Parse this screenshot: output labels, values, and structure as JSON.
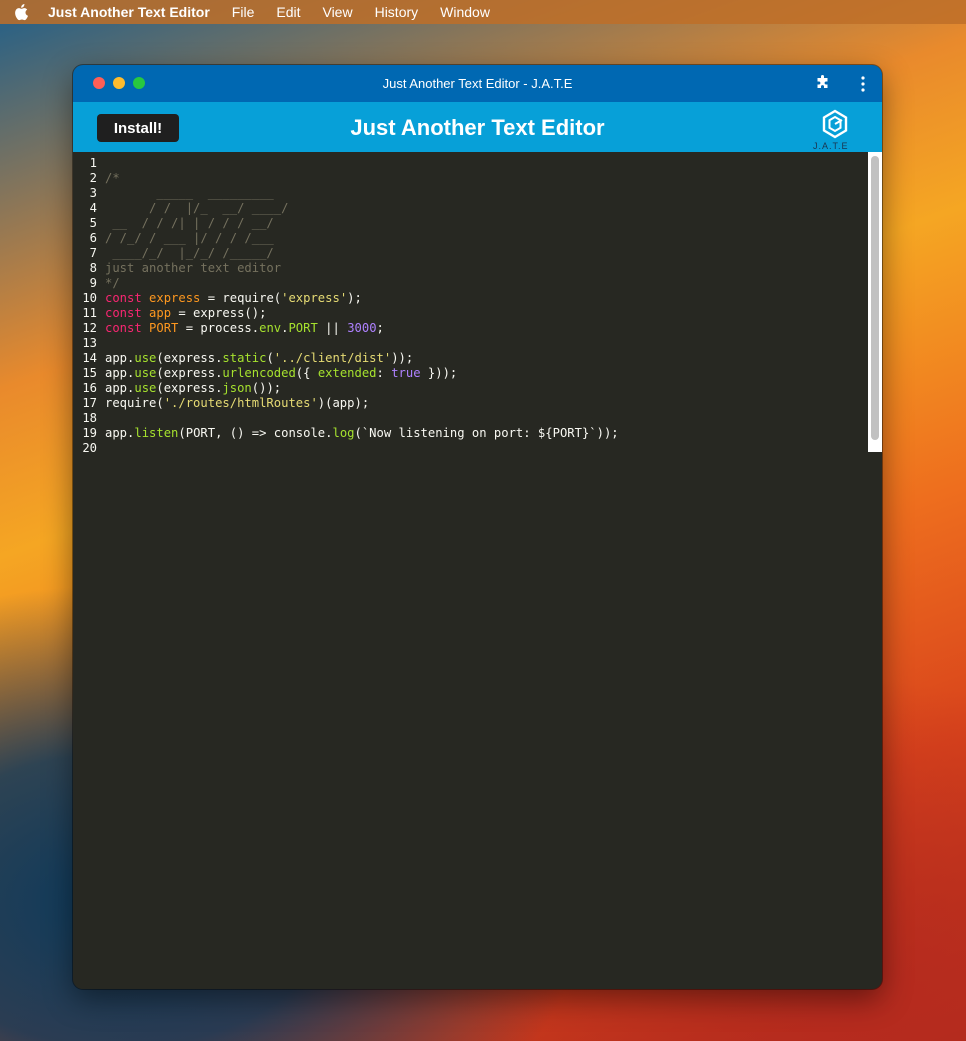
{
  "menubar": {
    "app_name": "Just Another Text Editor",
    "items": [
      "File",
      "Edit",
      "View",
      "History",
      "Window"
    ]
  },
  "window": {
    "title": "Just Another Text Editor - J.A.T.E"
  },
  "header": {
    "install_label": "Install!",
    "title": "Just Another Text Editor",
    "logo_text": "J.A.T.E"
  },
  "editor": {
    "lines": [
      {
        "n": "1",
        "t": [
          {
            "c": "",
            "t": ""
          }
        ]
      },
      {
        "n": "2",
        "t": [
          {
            "c": "c",
            "t": "/*"
          }
        ]
      },
      {
        "n": "3",
        "t": [
          {
            "c": "c",
            "t": "       _____  _________"
          }
        ]
      },
      {
        "n": "4",
        "t": [
          {
            "c": "c",
            "t": "      / /  |/_  __/ ____/"
          }
        ]
      },
      {
        "n": "5",
        "t": [
          {
            "c": "c",
            "t": " __  / / /| | / / / __/"
          }
        ]
      },
      {
        "n": "6",
        "t": [
          {
            "c": "c",
            "t": "/ /_/ / ___ |/ / / /___"
          }
        ]
      },
      {
        "n": "7",
        "t": [
          {
            "c": "c",
            "t": " ____/_/  |_/_/ /_____/"
          }
        ]
      },
      {
        "n": "8",
        "t": [
          {
            "c": "c",
            "t": "just another text editor"
          }
        ]
      },
      {
        "n": "9",
        "t": [
          {
            "c": "c",
            "t": "*/"
          }
        ]
      },
      {
        "n": "10",
        "t": [
          {
            "c": "k",
            "t": "const "
          },
          {
            "c": "v",
            "t": "express"
          },
          {
            "c": "",
            "t": " = require("
          },
          {
            "c": "s",
            "t": "'express'"
          },
          {
            "c": "",
            "t": ");"
          }
        ]
      },
      {
        "n": "11",
        "t": [
          {
            "c": "k",
            "t": "const "
          },
          {
            "c": "v",
            "t": "app"
          },
          {
            "c": "",
            "t": " = express();"
          }
        ]
      },
      {
        "n": "12",
        "t": [
          {
            "c": "k",
            "t": "const "
          },
          {
            "c": "v",
            "t": "PORT"
          },
          {
            "c": "",
            "t": " = process."
          },
          {
            "c": "f",
            "t": "env"
          },
          {
            "c": "",
            "t": "."
          },
          {
            "c": "f",
            "t": "PORT"
          },
          {
            "c": "",
            "t": " || "
          },
          {
            "c": "n",
            "t": "3000"
          },
          {
            "c": "",
            "t": ";"
          }
        ]
      },
      {
        "n": "13",
        "t": [
          {
            "c": "",
            "t": ""
          }
        ]
      },
      {
        "n": "14",
        "t": [
          {
            "c": "",
            "t": "app."
          },
          {
            "c": "f",
            "t": "use"
          },
          {
            "c": "",
            "t": "(express."
          },
          {
            "c": "f",
            "t": "static"
          },
          {
            "c": "",
            "t": "("
          },
          {
            "c": "s",
            "t": "'../client/dist'"
          },
          {
            "c": "",
            "t": "));"
          }
        ]
      },
      {
        "n": "15",
        "t": [
          {
            "c": "",
            "t": "app."
          },
          {
            "c": "f",
            "t": "use"
          },
          {
            "c": "",
            "t": "(express."
          },
          {
            "c": "f",
            "t": "urlencoded"
          },
          {
            "c": "",
            "t": "({ "
          },
          {
            "c": "f",
            "t": "extended"
          },
          {
            "c": "",
            "t": ": "
          },
          {
            "c": "n",
            "t": "true"
          },
          {
            "c": "",
            "t": " }));"
          }
        ]
      },
      {
        "n": "16",
        "t": [
          {
            "c": "",
            "t": "app."
          },
          {
            "c": "f",
            "t": "use"
          },
          {
            "c": "",
            "t": "(express."
          },
          {
            "c": "f",
            "t": "json"
          },
          {
            "c": "",
            "t": "());"
          }
        ]
      },
      {
        "n": "17",
        "t": [
          {
            "c": "",
            "t": "require("
          },
          {
            "c": "s",
            "t": "'./routes/htmlRoutes'"
          },
          {
            "c": "",
            "t": ")(app);"
          }
        ]
      },
      {
        "n": "18",
        "t": [
          {
            "c": "",
            "t": ""
          }
        ]
      },
      {
        "n": "19",
        "t": [
          {
            "c": "",
            "t": "app."
          },
          {
            "c": "f",
            "t": "listen"
          },
          {
            "c": "",
            "t": "(PORT, () => console."
          },
          {
            "c": "f",
            "t": "log"
          },
          {
            "c": "",
            "t": "(`Now listening on port: ${PORT}`));"
          }
        ]
      },
      {
        "n": "20",
        "t": [
          {
            "c": "",
            "t": ""
          }
        ]
      }
    ]
  },
  "colors": {
    "titlebar": "#0068b2",
    "header": "#07a0d8",
    "editor_bg": "#272822",
    "keyword": "#f92672",
    "string": "#e6db74",
    "number": "#ae81ff",
    "function": "#a6e22e",
    "variable": "#fd971f",
    "comment": "#75715e"
  }
}
